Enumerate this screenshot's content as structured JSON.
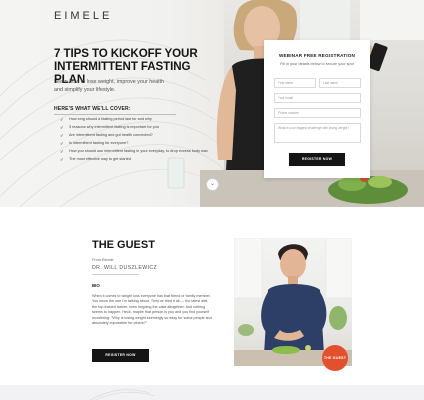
{
  "brand": {
    "logo": "EIMELE"
  },
  "hero": {
    "title": "7 TIPS TO KICKOFF YOUR INTERMITTENT FASTING PLAN",
    "subtitle_line1": "Learn how to lose weight, improve your health",
    "subtitle_line2": "and simplify your lifestyle.",
    "cover_heading": "HERE'S WHAT WE'LL COVER:",
    "checklist": [
      "How long should a fasting period last for and why",
      "3 reasons why intermittent fasting is important for you",
      "Are intermittent fasting and gut health connected?",
      "Is intermittent fasting for everyone?",
      "How you should use intermittent fasting in your everyday, to drop excess body wax",
      "The most effective way to get started"
    ],
    "scroll_icon": "chevron-down-icon",
    "scroll_glyph": "⌄"
  },
  "form": {
    "title": "WEBINAR FREE REGISTRATION",
    "subtitle": "Fill in your details below to secure your spot",
    "first_name_placeholder": "First name",
    "last_name_placeholder": "Last name",
    "email_placeholder": "Your email",
    "phone_placeholder": "Phone number",
    "question_placeholder": "What is your biggest challenge with losing weight?",
    "submit_label": "REGISTER NOW"
  },
  "guest": {
    "title": "THE GUEST",
    "from": "From Eimele",
    "name": "DR. WILL DUSZLEWICZ",
    "bio_heading": "BIO",
    "bio": "When it comes to weight loss everyone has that friend or family member. You know the one I'm talking about. They've tried it all — the latest diet, the top-trained trainer, even forgoing the cake altogether. And nothing seems to happen. Heck, maybe that person is you and you find yourself wondering: \"Why is losing weight seemingly so easy for some people and absolutely impossible for others?\"",
    "button_label": "REGISTER NOW",
    "badge": "THE GUEST"
  },
  "colors": {
    "accent": "#e2502e",
    "button": "#151515"
  }
}
